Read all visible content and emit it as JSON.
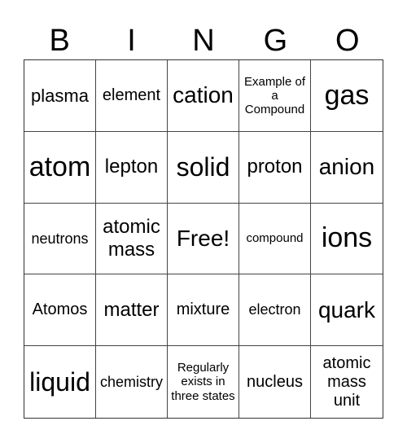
{
  "header": {
    "letters": [
      "B",
      "I",
      "N",
      "G",
      "O"
    ]
  },
  "board": {
    "rows": [
      [
        "plasma",
        "element",
        "cation",
        "Example of a Compound",
        "gas"
      ],
      [
        "atom",
        "lepton",
        "solid",
        "proton",
        "anion"
      ],
      [
        "neutrons",
        "atomic mass",
        "Free!",
        "compound",
        "ions"
      ],
      [
        "Atomos",
        "matter",
        "mixture",
        "electron",
        "quark"
      ],
      [
        "liquid",
        "chemistry",
        "Regularly exists in three states",
        "nucleus",
        "atomic mass unit"
      ]
    ],
    "free_space_label": "Free!"
  }
}
